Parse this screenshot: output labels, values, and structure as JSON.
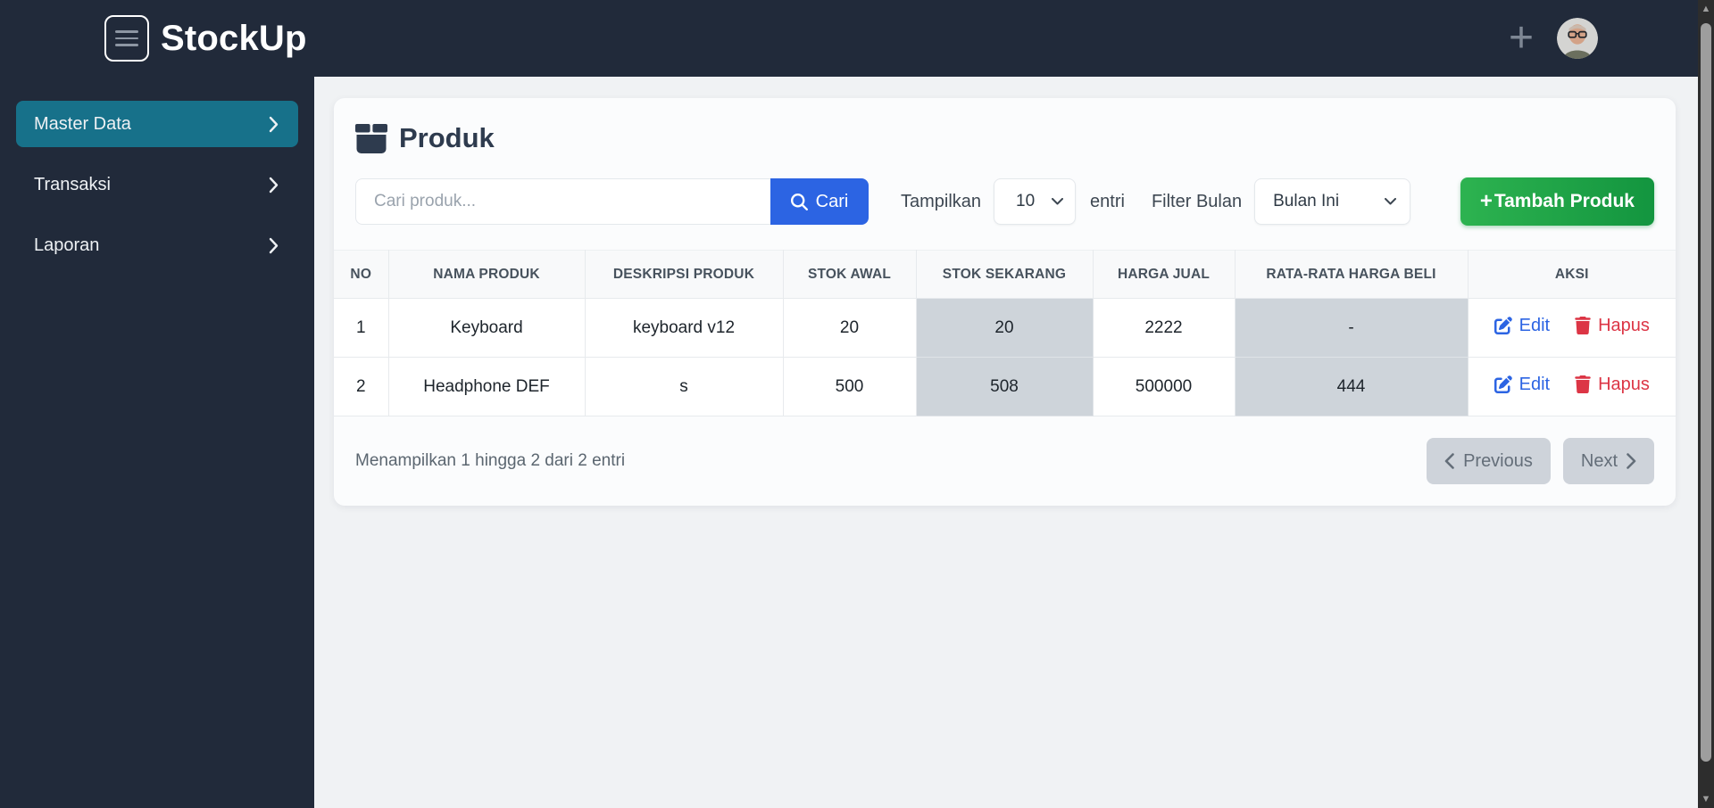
{
  "topbar": {
    "brand": "StockUp"
  },
  "sidebar": {
    "items": [
      {
        "label": "Master Data",
        "active": true
      },
      {
        "label": "Transaksi",
        "active": false
      },
      {
        "label": "Laporan",
        "active": false
      }
    ]
  },
  "page": {
    "title": "Produk",
    "search": {
      "placeholder": "Cari produk...",
      "button": "Cari"
    },
    "show": {
      "label": "Tampilkan",
      "value": "10",
      "suffix": "entri"
    },
    "filter": {
      "label": "Filter Bulan",
      "value": "Bulan Ini"
    },
    "add": {
      "plus": "+",
      "label": "Tambah Produk"
    }
  },
  "table": {
    "columns": [
      "NO",
      "NAMA PRODUK",
      "DESKRIPSI PRODUK",
      "STOK AWAL",
      "STOK SEKARANG",
      "HARGA JUAL",
      "RATA-RATA HARGA BELI",
      "AKSI"
    ],
    "rows": [
      [
        "1",
        "Keyboard",
        "keyboard v12",
        "20",
        "20",
        "2222",
        "-"
      ],
      [
        "2",
        "Headphone DEF",
        "s",
        "500",
        "508",
        "500000",
        "444"
      ]
    ],
    "actions": {
      "edit": "Edit",
      "delete": "Hapus"
    }
  },
  "pagination": {
    "summary": "Menampilkan 1 hingga 2 dari 2 entri",
    "previous": "Previous",
    "next": "Next"
  },
  "colors": {
    "topbar_bg": "#212a3a",
    "sidebar_active": "#17718a",
    "primary_blue": "#2c64e3",
    "add_green_from": "#2db350",
    "add_green_to": "#13953f",
    "danger_red": "#dc3545",
    "shaded_cell": "#ced4da"
  }
}
